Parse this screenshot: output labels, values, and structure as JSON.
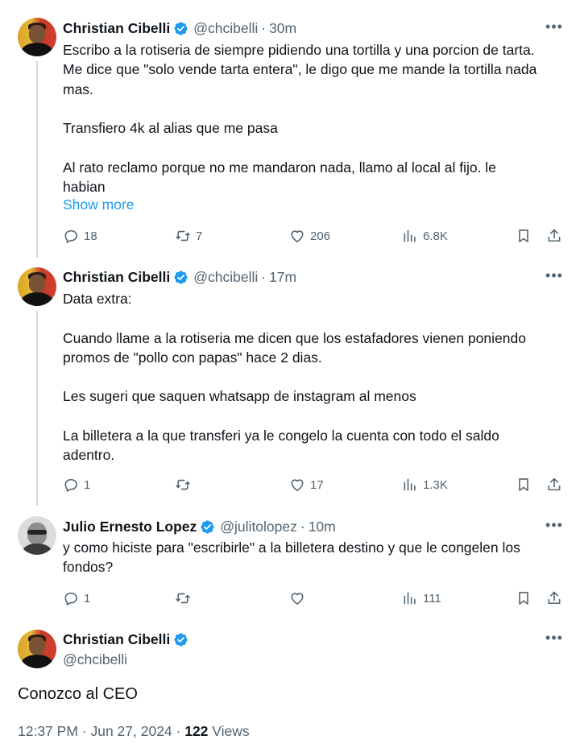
{
  "tweets": [
    {
      "name": "Christian Cibelli",
      "handle": "@chcibelli",
      "time": "30m",
      "lines": [
        "Escribo a la rotiseria de siempre pidiendo una tortilla y una porcion de tarta.",
        "Me dice que \"solo vende tarta entera\", le digo que me mande la tortilla nada",
        "mas.",
        "",
        "Transfiero 4k al alias que me pasa",
        "",
        "Al rato reclamo porque no me mandaron nada, llamo al local al fijo. le",
        "habian"
      ],
      "show_more": "Show more",
      "replies": "18",
      "reposts": "7",
      "likes": "206",
      "views": "6.8K"
    },
    {
      "name": "Christian Cibelli",
      "handle": "@chcibelli",
      "time": "17m",
      "lines": [
        "Data extra:",
        "",
        "Cuando llame a la rotiseria me dicen que los estafadores vienen poniendo",
        "promos de \"pollo con papas\" hace 2 dias.",
        "",
        "Les sugeri que saquen whatsapp de instagram al menos",
        "",
        "La billetera a la que transferi ya le congelo la cuenta con todo el saldo",
        "adentro."
      ],
      "replies": "1",
      "reposts": "",
      "likes": "17",
      "views": "1.3K"
    },
    {
      "name": "Julio Ernesto Lopez",
      "handle": "@julitolopez",
      "time": "10m",
      "lines": [
        "y como hiciste para \"escribirle\" a la billetera destino y que le congelen los",
        "fondos?"
      ],
      "replies": "1",
      "reposts": "",
      "likes": "",
      "views": "111"
    }
  ],
  "main_tweet": {
    "name": "Christian Cibelli",
    "handle": "@chcibelli",
    "text": "Conozco al CEO",
    "timestamp": "12:37 PM · Jun 27, 2024 · ",
    "views_count": "122",
    "views_label": " Views"
  },
  "dot": "·",
  "colors": {
    "accent": "#1d9bf0",
    "secondary": "#536471",
    "text": "#0f1419",
    "thread": "#cfd9de"
  }
}
